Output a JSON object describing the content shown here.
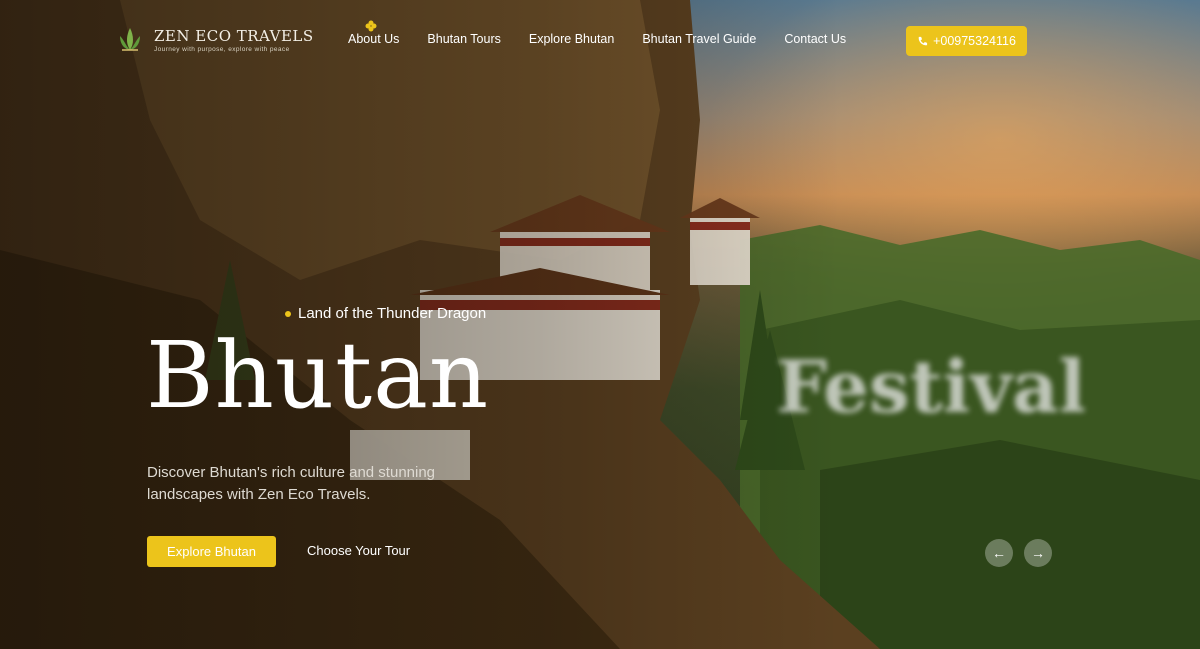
{
  "brand": {
    "name": "ZEN ECO TRAVELS",
    "tagline": "Journey with purpose, explore with peace"
  },
  "nav": {
    "items": [
      "About Us",
      "Bhutan Tours",
      "Explore Bhutan",
      "Bhutan Travel Guide",
      "Contact Us"
    ]
  },
  "contact": {
    "phone": "+00975324116"
  },
  "hero": {
    "eyebrow": "Land of the Thunder Dragon",
    "headline": "Bhutan",
    "ghost_headline": "Festival",
    "description": "Discover Bhutan's rich culture and stunning landscapes with Zen Eco Travels.",
    "primary_cta": "Explore Bhutan",
    "secondary_cta": "Choose Your Tour"
  },
  "carousel": {
    "prev_icon": "←",
    "next_icon": "→"
  },
  "colors": {
    "accent": "#ecc41b"
  }
}
